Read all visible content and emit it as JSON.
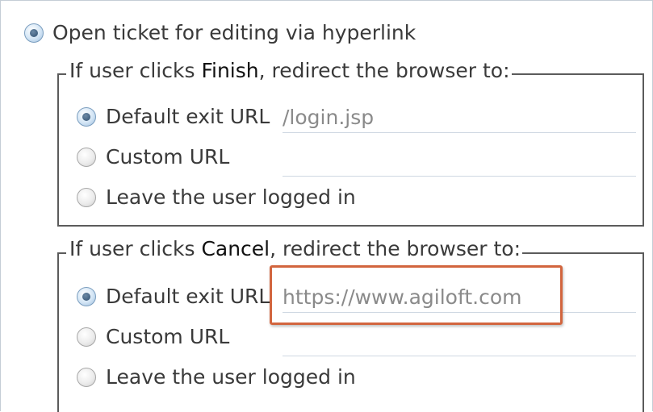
{
  "top_option": {
    "label": "Open ticket for editing via hyperlink",
    "selected": true
  },
  "finish_group": {
    "legend_prefix": "If user clicks ",
    "legend_keyword": "Finish",
    "legend_suffix": ", redirect the browser to:",
    "options": [
      {
        "label": "Default exit URL",
        "selected": true,
        "value": "/login.jsp"
      },
      {
        "label": "Custom URL",
        "selected": false,
        "value": ""
      },
      {
        "label": "Leave the user logged in",
        "selected": false
      }
    ]
  },
  "cancel_group": {
    "legend_prefix": "If user clicks ",
    "legend_keyword": "Cancel",
    "legend_suffix": ", redirect the browser to:",
    "options": [
      {
        "label": "Default exit URL",
        "selected": true,
        "value": "https://www.agiloft.com"
      },
      {
        "label": "Custom URL",
        "selected": false,
        "value": ""
      },
      {
        "label": "Leave the user logged in",
        "selected": false
      }
    ]
  },
  "colors": {
    "highlight": "#d2653e",
    "radio_selected": "#2f4f70",
    "group_border": "#5b5b5b"
  }
}
